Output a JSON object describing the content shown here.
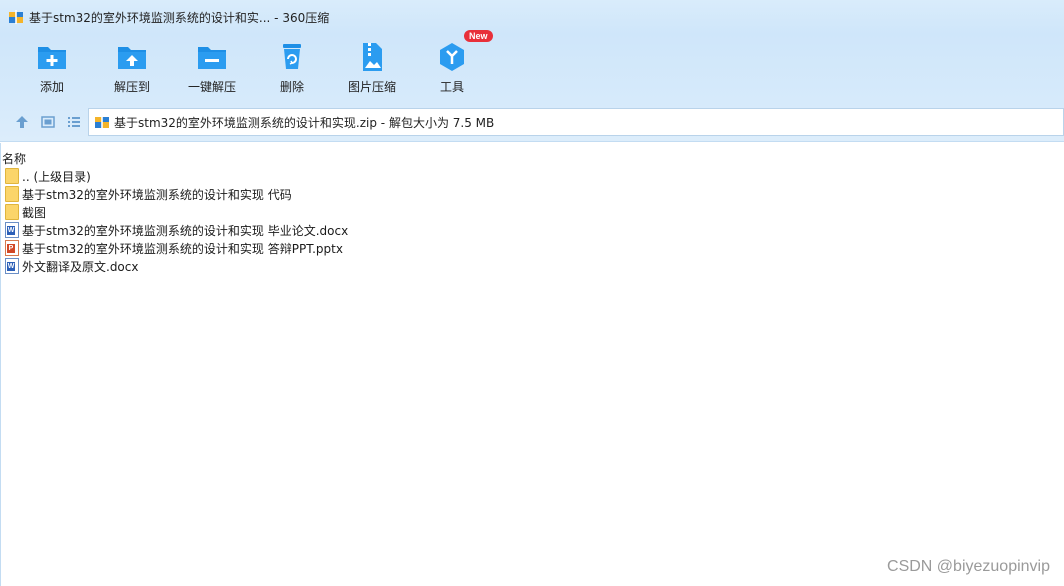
{
  "window": {
    "title": "基于stm32的室外环境监测系统的设计和实... - 360压缩",
    "app_icon": "360-zip-icon"
  },
  "toolbar": {
    "buttons": [
      {
        "label": "添加",
        "icon": "add-file-icon"
      },
      {
        "label": "解压到",
        "icon": "extract-to-icon"
      },
      {
        "label": "一键解压",
        "icon": "one-click-extract-icon"
      },
      {
        "label": "删除",
        "icon": "delete-icon"
      },
      {
        "label": "图片压缩",
        "icon": "image-compress-icon"
      },
      {
        "label": "工具",
        "icon": "tools-icon",
        "badge": "New"
      }
    ]
  },
  "address": {
    "path": "基于stm32的室外环境监测系统的设计和实现.zip - 解包大小为 7.5 MB"
  },
  "filelist": {
    "column_name": "名称",
    "rows": [
      {
        "name": ".. (上级目录)",
        "type": "folder"
      },
      {
        "name": "基于stm32的室外环境监测系统的设计和实现 代码",
        "type": "folder"
      },
      {
        "name": "截图",
        "type": "folder"
      },
      {
        "name": "基于stm32的室外环境监测系统的设计和实现 毕业论文.docx",
        "type": "docx"
      },
      {
        "name": "基于stm32的室外环境监测系统的设计和实现 答辩PPT.pptx",
        "type": "pptx"
      },
      {
        "name": "外文翻译及原文.docx",
        "type": "docx"
      }
    ]
  },
  "watermark": "CSDN @biyezuopinvip",
  "colors": {
    "toolbar_icon": "#1e8fe6",
    "badge": "#e8303a",
    "folder": "#fbd56a"
  }
}
